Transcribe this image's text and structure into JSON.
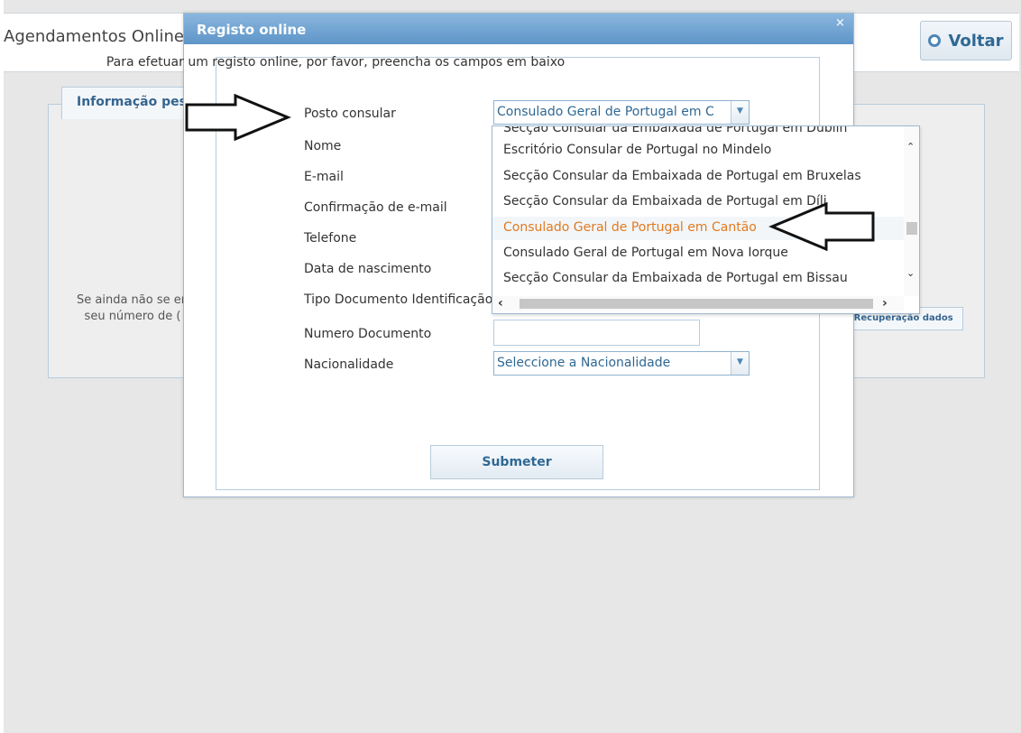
{
  "page": {
    "title": "Agendamentos Online",
    "back_button": "Voltar",
    "section_legend": "Informação pess",
    "note_line1": "Se ainda não se en",
    "note_line2": "seu número de (",
    "recovery_link": "/Recuperação dados"
  },
  "modal": {
    "title": "Registo online",
    "close_symbol": "×",
    "intro": "Para efetuar um registo online, por favor, preencha os campos em baixo",
    "fields": {
      "posto": {
        "label": "Posto consular",
        "value": "Consulado Geral de Portugal em C"
      },
      "nome": {
        "label": "Nome"
      },
      "email": {
        "label": "E-mail"
      },
      "email_confirm": {
        "label": "Confirmação de e-mail"
      },
      "telefone": {
        "label": "Telefone"
      },
      "nascimento": {
        "label": "Data de nascimento"
      },
      "tipo_doc": {
        "label": "Tipo Documento Identificação"
      },
      "numero_doc": {
        "label": "Numero Documento",
        "value": ""
      },
      "nacionalidade": {
        "label": "Nacionalidade",
        "value": "Seleccione a Nacionalidade"
      }
    },
    "submit_label": "Submeter"
  },
  "dropdown": {
    "selected_index": 4,
    "items": [
      "Secção Consular da Embaixada de Portugal em Dublin",
      "Escritório Consular de Portugal no Mindelo",
      "Secção Consular da Embaixada de Portugal em Bruxelas",
      "Secção Consular da Embaixada de Portugal em Díli",
      "Consulado Geral de Portugal em Cantão",
      "Consulado Geral de Portugal em Nova Iorque",
      "Secção Consular da Embaixada de Portugal em Bissau"
    ]
  },
  "colors": {
    "accent": "#2f6894",
    "selected_item": "#e07a20",
    "modal_header": "#6a9fd0"
  },
  "icons": {
    "voltar": "circle-bullet-icon",
    "select": "chevron-down-icon",
    "annotation_left": "outline-arrow-right-icon",
    "annotation_right": "outline-arrow-left-icon"
  }
}
